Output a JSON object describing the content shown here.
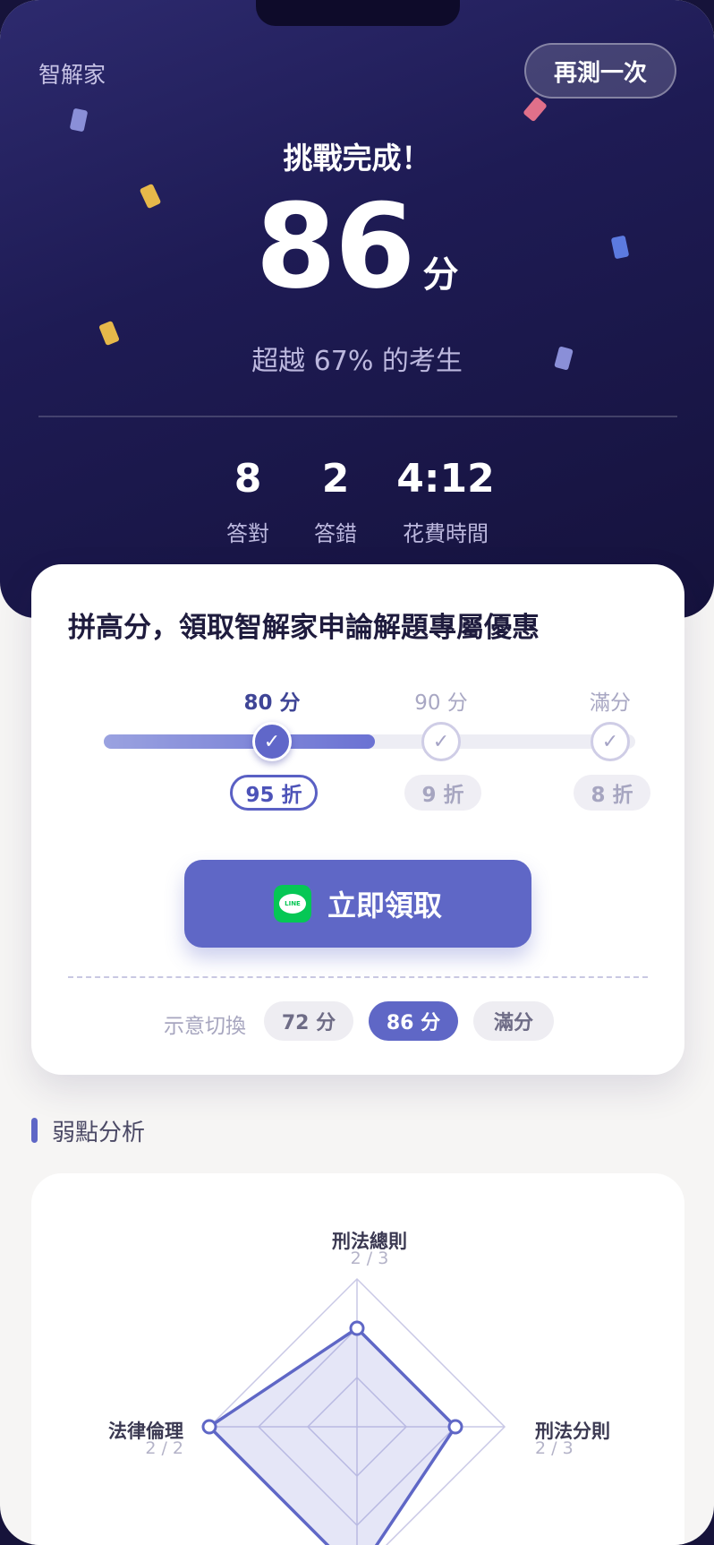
{
  "header": {
    "brand": "智解家",
    "retake_label": "再測一次"
  },
  "result": {
    "title": "挑戰完成！",
    "score": "86",
    "score_unit": "分",
    "percentile_text": "超越 67% 的考生",
    "stats": [
      {
        "value": "8",
        "label": "答對"
      },
      {
        "value": "2",
        "label": "答錯"
      },
      {
        "value": "4:12",
        "label": "花費時間"
      }
    ]
  },
  "offer": {
    "title": "拼高分，領取智解家申論解題專屬優惠",
    "progress": 0.51,
    "tiers": [
      {
        "label": "80 分",
        "discount": "95 折",
        "reached": true,
        "check": "✓"
      },
      {
        "label": "90 分",
        "discount": "9 折",
        "reached": false,
        "check": "✓"
      },
      {
        "label": "滿分",
        "discount": "8 折",
        "reached": false,
        "check": "✓"
      }
    ],
    "claim_label": "立即領取",
    "line_icon_text": "LINE",
    "switch_label": "示意切換",
    "switch_options": [
      "72 分",
      "86 分",
      "滿分"
    ],
    "switch_selected": "86 分"
  },
  "weakness": {
    "title": "弱點分析",
    "chart_data": {
      "type": "radar",
      "axes": [
        {
          "name": "刑法總則",
          "score": "2 / 3",
          "value": 2,
          "max": 3
        },
        {
          "name": "刑法分則",
          "score": "2 / 3",
          "value": 2,
          "max": 3
        },
        {
          "name": "法律倫理",
          "score": "2 / 2",
          "value": 2,
          "max": 2
        }
      ]
    }
  },
  "colors": {
    "accent": "#5f67c6",
    "line_green": "#06c755",
    "hero_bg": "#1e1b54"
  }
}
